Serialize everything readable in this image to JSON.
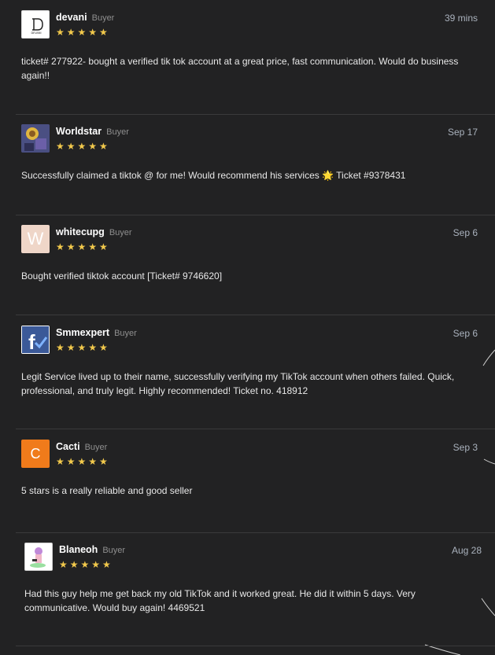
{
  "reviews": [
    {
      "name": "devani",
      "role": "Buyer",
      "time": "39 mins",
      "stars": "★★★★★",
      "text": "ticket# 277922- bought a verified tik tok account at a great price, fast communication. Would do business again!!",
      "avatar": {
        "kind": "logo-icon",
        "bg": "#ffffff"
      }
    },
    {
      "name": "Worldstar",
      "role": "Buyer",
      "time": "Sep 17",
      "stars": "★★★★★",
      "text": "Successfully claimed a tiktok @ for me! Would recommend his services 🌟 Ticket #9378431",
      "avatar": {
        "kind": "character-icon",
        "bg": "#3b3b6b"
      }
    },
    {
      "name": "whitecupg",
      "role": "Buyer",
      "time": "Sep 6",
      "stars": "★★★★★",
      "text": "Bought verified tiktok account [Ticket# 9746620]",
      "avatar": {
        "kind": "letter",
        "letter": "W",
        "bg": "#efd6c8"
      }
    },
    {
      "name": "Smmexpert",
      "role": "Buyer",
      "time": "Sep 6",
      "stars": "★★★★★",
      "text": "Legit Service lived up to their name, successfully verifying my TikTok account when others failed. Quick, professional, and truly legit. Highly recommended! Ticket no. 418912",
      "avatar": {
        "kind": "facebook-check-icon",
        "bg": "#3b5998"
      }
    },
    {
      "name": "Cacti",
      "role": "Buyer",
      "time": "Sep 3",
      "stars": "★★★★★",
      "text": "5 stars is a really reliable and good seller",
      "avatar": {
        "kind": "letter",
        "letter": "C",
        "bg": "#f07b1b"
      }
    },
    {
      "name": "Blaneoh",
      "role": "Buyer",
      "time": "Aug 28",
      "stars": "★★★★★",
      "text": "Had this guy help me get back my old TikTok and it worked great. He did it within 5 days. Very communicative. Would buy again! 4469521",
      "avatar": {
        "kind": "character-icon",
        "bg": "#ffffff"
      }
    }
  ]
}
